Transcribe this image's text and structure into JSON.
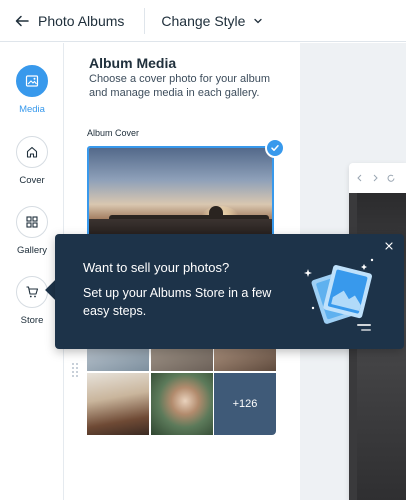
{
  "topbar": {
    "back_label": "Photo Albums",
    "style_label": "Change Style"
  },
  "rail": {
    "items": [
      {
        "label": "Media",
        "icon": "image-icon",
        "active": true
      },
      {
        "label": "Cover",
        "icon": "home-icon",
        "active": false
      },
      {
        "label": "Gallery",
        "icon": "grid-icon",
        "active": false
      },
      {
        "label": "Store",
        "icon": "cart-icon",
        "active": false
      }
    ]
  },
  "panel": {
    "title": "Album Media",
    "description": "Choose a cover photo for your album and manage media in each gallery.",
    "cover_label": "Album Cover",
    "more_count": "+126"
  },
  "tooltip": {
    "title": "Want to sell your photos?",
    "body": "Set up your Albums Store in a few easy steps."
  },
  "colors": {
    "accent": "#3899ec",
    "tooltip_bg": "#1d3349",
    "stage_bg": "#eef1f4"
  }
}
